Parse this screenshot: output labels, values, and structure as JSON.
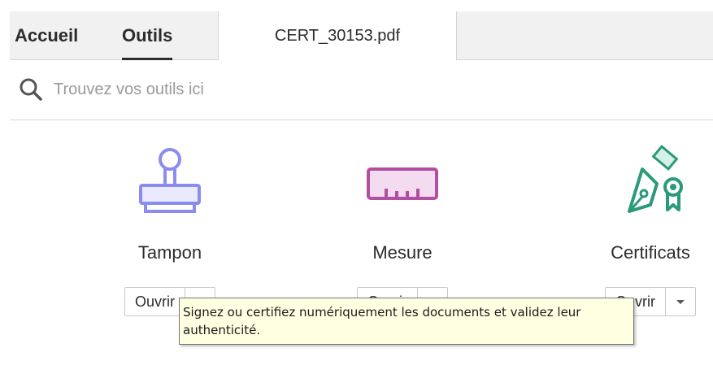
{
  "tabs": {
    "home": "Accueil",
    "tools": "Outils",
    "document": "CERT_30153.pdf"
  },
  "search": {
    "placeholder": "Trouvez vos outils ici",
    "value": ""
  },
  "tools": [
    {
      "name": "Tampon",
      "open_label": "Ouvrir",
      "icon": "stamp-icon",
      "color": "#8a8cf0"
    },
    {
      "name": "Mesure",
      "open_label": "Ouvrir",
      "icon": "ruler-icon",
      "color": "#b24fa0"
    },
    {
      "name": "Certificats",
      "open_label": "Ouvrir",
      "icon": "certificate-pen-icon",
      "color": "#2a9a7a"
    }
  ],
  "tooltip": {
    "text": "Signez ou certifiez numériquement les documents et validez leur authenticité."
  }
}
